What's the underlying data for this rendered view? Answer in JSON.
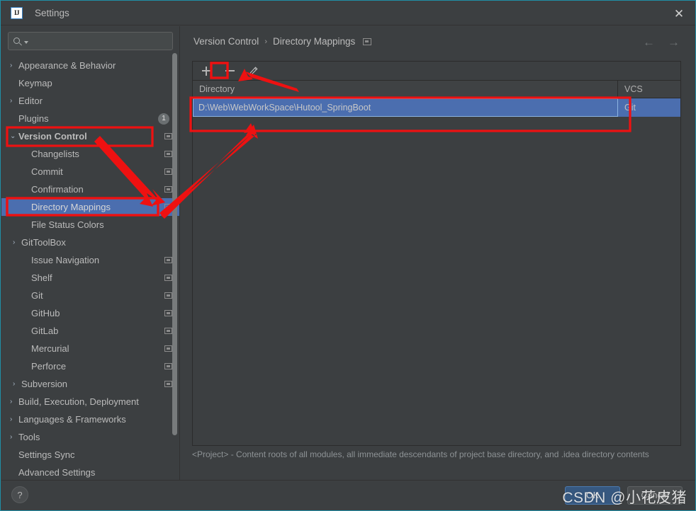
{
  "window": {
    "title": "Settings",
    "logo_text": "IJ",
    "close_label": "✕"
  },
  "search": {
    "value": "",
    "placeholder": ""
  },
  "sidebar": {
    "items": [
      {
        "label": "Appearance & Behavior",
        "level": 0,
        "arrow": "›",
        "selected": false,
        "proj_icon": false,
        "badge": null
      },
      {
        "label": "Keymap",
        "level": 0,
        "arrow": "",
        "selected": false,
        "proj_icon": false,
        "badge": null
      },
      {
        "label": "Editor",
        "level": 0,
        "arrow": "›",
        "selected": false,
        "proj_icon": false,
        "badge": null
      },
      {
        "label": "Plugins",
        "level": 0,
        "arrow": "",
        "selected": false,
        "proj_icon": false,
        "badge": "1"
      },
      {
        "label": "Version Control",
        "level": 0,
        "arrow": "⌄",
        "selected": false,
        "proj_icon": true,
        "badge": null,
        "bold": true
      },
      {
        "label": "Changelists",
        "level": 1,
        "arrow": "",
        "selected": false,
        "proj_icon": true,
        "badge": null
      },
      {
        "label": "Commit",
        "level": 1,
        "arrow": "",
        "selected": false,
        "proj_icon": true,
        "badge": null
      },
      {
        "label": "Confirmation",
        "level": 1,
        "arrow": "",
        "selected": false,
        "proj_icon": true,
        "badge": null
      },
      {
        "label": "Directory Mappings",
        "level": 1,
        "arrow": "",
        "selected": true,
        "proj_icon": true,
        "badge": null
      },
      {
        "label": "File Status Colors",
        "level": 1,
        "arrow": "",
        "selected": false,
        "proj_icon": false,
        "badge": null
      },
      {
        "label": "GitToolBox",
        "level": 1,
        "arrow": "›",
        "selected": false,
        "proj_icon": false,
        "badge": null
      },
      {
        "label": "Issue Navigation",
        "level": 1,
        "arrow": "",
        "selected": false,
        "proj_icon": true,
        "badge": null
      },
      {
        "label": "Shelf",
        "level": 1,
        "arrow": "",
        "selected": false,
        "proj_icon": true,
        "badge": null
      },
      {
        "label": "Git",
        "level": 1,
        "arrow": "",
        "selected": false,
        "proj_icon": true,
        "badge": null
      },
      {
        "label": "GitHub",
        "level": 1,
        "arrow": "",
        "selected": false,
        "proj_icon": true,
        "badge": null
      },
      {
        "label": "GitLab",
        "level": 1,
        "arrow": "",
        "selected": false,
        "proj_icon": true,
        "badge": null
      },
      {
        "label": "Mercurial",
        "level": 1,
        "arrow": "",
        "selected": false,
        "proj_icon": true,
        "badge": null
      },
      {
        "label": "Perforce",
        "level": 1,
        "arrow": "",
        "selected": false,
        "proj_icon": true,
        "badge": null
      },
      {
        "label": "Subversion",
        "level": 1,
        "arrow": "›",
        "selected": false,
        "proj_icon": true,
        "badge": null
      },
      {
        "label": "Build, Execution, Deployment",
        "level": 0,
        "arrow": "›",
        "selected": false,
        "proj_icon": false,
        "badge": null
      },
      {
        "label": "Languages & Frameworks",
        "level": 0,
        "arrow": "›",
        "selected": false,
        "proj_icon": false,
        "badge": null
      },
      {
        "label": "Tools",
        "level": 0,
        "arrow": "›",
        "selected": false,
        "proj_icon": false,
        "badge": null
      },
      {
        "label": "Settings Sync",
        "level": 0,
        "arrow": "",
        "selected": false,
        "proj_icon": false,
        "badge": null
      },
      {
        "label": "Advanced Settings",
        "level": 0,
        "arrow": "",
        "selected": false,
        "proj_icon": false,
        "badge": null
      }
    ]
  },
  "main": {
    "breadcrumb": {
      "parent": "Version Control",
      "separator": "›",
      "current": "Directory Mappings"
    },
    "nav": {
      "back": "←",
      "forward": "→"
    },
    "toolbar": {
      "add_label": "+",
      "remove_label": "−",
      "edit_label": "edit-pencil"
    },
    "table": {
      "columns": [
        "Directory",
        "VCS"
      ],
      "rows": [
        {
          "directory": "D:\\Web\\WebWorkSpace\\Hutool_SpringBoot",
          "vcs": "Git",
          "selected": true,
          "editing": true
        }
      ]
    },
    "footer_note": "<Project> - Content roots of all modules, all immediate descendants of project base directory, and .idea directory contents"
  },
  "bottom": {
    "help_label": "?",
    "ok_label": "OK",
    "cancel_label": "Cancel"
  },
  "watermark": {
    "text": "CSDN @小花皮猪"
  },
  "colors": {
    "window_bg": "#3c3f41",
    "selection_blue": "#4b6eaf",
    "primary_button": "#365880",
    "annotation_red": "#ee1111",
    "accent_border": "#1f8fa6",
    "text": "#bbbbbb"
  }
}
